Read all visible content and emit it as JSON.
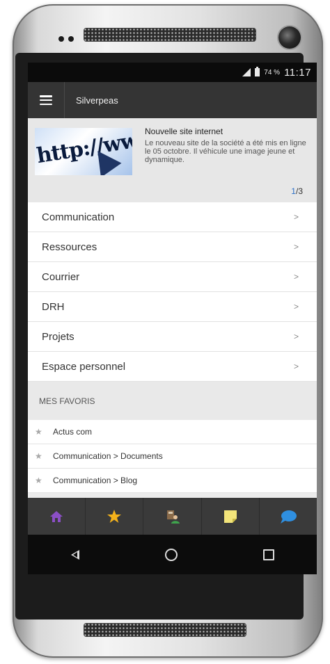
{
  "status_bar": {
    "battery_percent": "74 %",
    "time": "11:17",
    "icons": [
      "signal-icon",
      "battery-icon"
    ]
  },
  "app_bar": {
    "title": "Silverpeas",
    "menu_icon": "hamburger-menu-icon"
  },
  "news": {
    "thumbnail_text": "http://www",
    "title": "Nouvelle site internet",
    "text": "Le nouveau site de la société a été mis en ligne le 05 octobre. Il véhicule une image jeune et dynamique.",
    "pager_current": "1",
    "pager_total": "/3"
  },
  "menu": {
    "items": [
      {
        "label": "Communication",
        "chevron": ">"
      },
      {
        "label": "Ressources",
        "chevron": ">"
      },
      {
        "label": "Courrier",
        "chevron": ">"
      },
      {
        "label": "DRH",
        "chevron": ">"
      },
      {
        "label": "Projets",
        "chevron": ">"
      },
      {
        "label": "Espace personnel",
        "chevron": ">"
      }
    ]
  },
  "favorites": {
    "header": "MES FAVORIS",
    "items": [
      {
        "label": "Actus com"
      },
      {
        "label": "Communication > Documents"
      },
      {
        "label": "Communication > Blog"
      }
    ]
  },
  "bottom_nav": {
    "items": [
      "home-icon",
      "star-icon",
      "contacts-icon",
      "sticky-note-icon",
      "chat-bubble-icon"
    ],
    "colors": {
      "home": "#8b4fc6",
      "star": "#f4b21b",
      "note": "#f2e47a",
      "chat": "#2f8fe0"
    }
  },
  "system_nav": {
    "items": [
      "back-icon",
      "home-circle-icon",
      "recent-apps-icon"
    ]
  }
}
